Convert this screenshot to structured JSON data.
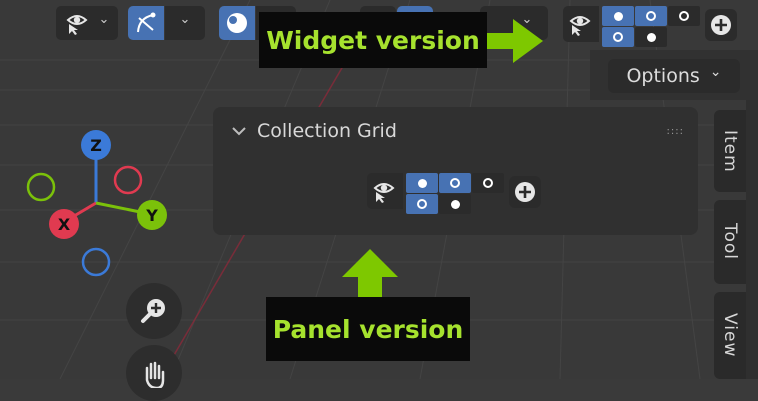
{
  "header": {
    "chevron": "⌄"
  },
  "options": {
    "label": "Options",
    "chevron": "⌄"
  },
  "sidebar": {
    "tabs": [
      {
        "label": "Item"
      },
      {
        "label": "Tool"
      },
      {
        "label": "View"
      }
    ]
  },
  "panel": {
    "title": "Collection Grid"
  },
  "callouts": {
    "widget": "Widget version",
    "panel": "Panel version"
  },
  "gizmo": {
    "z": "Z",
    "x": "X",
    "y": "Y"
  },
  "colors": {
    "accent_blue": "#4772b3",
    "callout_text": "#a6e22e",
    "arrow": "#7ec800",
    "axis_x": "#e03a50",
    "axis_y": "#7bc10a",
    "axis_z": "#3b7ad8"
  },
  "icons": [
    "visibility-select-icon",
    "chevron-down-icon",
    "gizmo-toggle-icon",
    "shading-sphere-icon",
    "plus-icon",
    "hand-pan-icon",
    "zoom-icon",
    "drag-grip-icon"
  ]
}
